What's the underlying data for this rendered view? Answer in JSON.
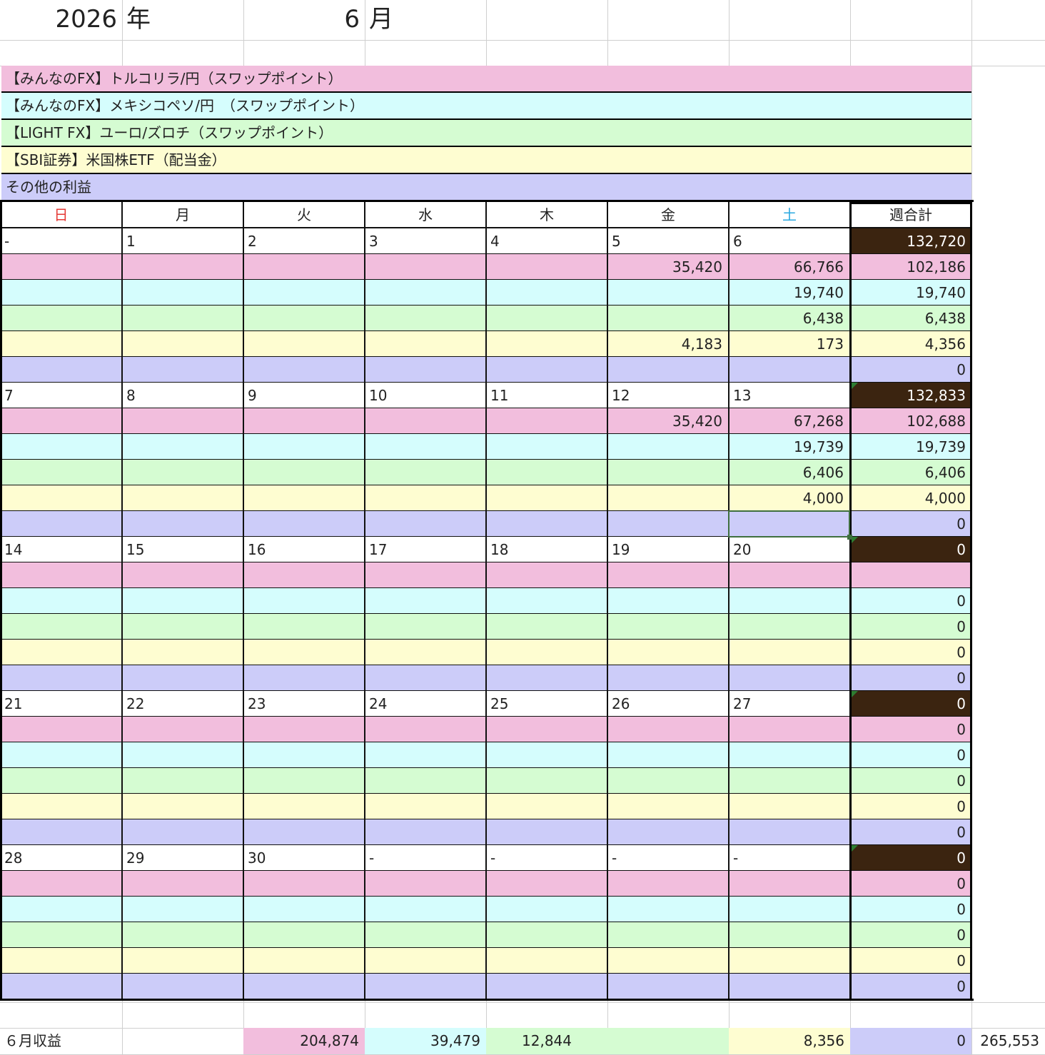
{
  "header": {
    "year": "2026",
    "year_unit": "年",
    "month": "6",
    "month_unit": "月"
  },
  "legend": [
    {
      "label": "【みんなのFX】トルコリラ/円（スワップポイント）",
      "color": "#f2bedd"
    },
    {
      "label": "【みんなのFX】メキシコペソ/円　（スワップポイント）",
      "color": "#d5fdfd"
    },
    {
      "label": "【LIGHT FX】ユーロ/ズロチ（スワップポイント）",
      "color": "#d5fcd2"
    },
    {
      "label": "【SBI証券】米国株ETF（配当金）",
      "color": "#fefdd1"
    },
    {
      "label": "その他の利益",
      "color": "#ccccf9"
    }
  ],
  "weekday_headers": [
    "日",
    "月",
    "火",
    "水",
    "木",
    "金",
    "土",
    "週合計"
  ],
  "weekday_colors": {
    "sunday": "#e53935",
    "saturday": "#29a8e0"
  },
  "weeks": [
    {
      "dates": [
        "-",
        "1",
        "2",
        "3",
        "4",
        "5",
        "6"
      ],
      "total": "132,720",
      "rows": [
        [
          "",
          "",
          "",
          "",
          "",
          "35,420",
          "66,766",
          "102,186"
        ],
        [
          "",
          "",
          "",
          "",
          "",
          "",
          "19,740",
          "19,740"
        ],
        [
          "",
          "",
          "",
          "",
          "",
          "",
          "6,438",
          "6,438"
        ],
        [
          "",
          "",
          "",
          "",
          "",
          "4,183",
          "173",
          "4,356"
        ],
        [
          "",
          "",
          "",
          "",
          "",
          "",
          "",
          "0"
        ]
      ]
    },
    {
      "dates": [
        "7",
        "8",
        "9",
        "10",
        "11",
        "12",
        "13"
      ],
      "total": "132,833",
      "rows": [
        [
          "",
          "",
          "",
          "",
          "",
          "35,420",
          "67,268",
          "102,688"
        ],
        [
          "",
          "",
          "",
          "",
          "",
          "",
          "19,739",
          "19,739"
        ],
        [
          "",
          "",
          "",
          "",
          "",
          "",
          "6,406",
          "6,406"
        ],
        [
          "",
          "",
          "",
          "",
          "",
          "",
          "4,000",
          "4,000"
        ],
        [
          "",
          "",
          "",
          "",
          "",
          "",
          "",
          "0"
        ]
      ]
    },
    {
      "dates": [
        "14",
        "15",
        "16",
        "17",
        "18",
        "19",
        "20"
      ],
      "total": "0",
      "rows": [
        [
          "",
          "",
          "",
          "",
          "",
          "",
          "",
          ""
        ],
        [
          "",
          "",
          "",
          "",
          "",
          "",
          "",
          "0"
        ],
        [
          "",
          "",
          "",
          "",
          "",
          "",
          "",
          "0"
        ],
        [
          "",
          "",
          "",
          "",
          "",
          "",
          "",
          "0"
        ],
        [
          "",
          "",
          "",
          "",
          "",
          "",
          "",
          "0"
        ]
      ]
    },
    {
      "dates": [
        "21",
        "22",
        "23",
        "24",
        "25",
        "26",
        "27"
      ],
      "total": "0",
      "rows": [
        [
          "",
          "",
          "",
          "",
          "",
          "",
          "",
          "0"
        ],
        [
          "",
          "",
          "",
          "",
          "",
          "",
          "",
          "0"
        ],
        [
          "",
          "",
          "",
          "",
          "",
          "",
          "",
          "0"
        ],
        [
          "",
          "",
          "",
          "",
          "",
          "",
          "",
          "0"
        ],
        [
          "",
          "",
          "",
          "",
          "",
          "",
          "",
          "0"
        ]
      ]
    },
    {
      "dates": [
        "28",
        "29",
        "30",
        "-",
        "-",
        "-",
        "-"
      ],
      "total": "0",
      "rows": [
        [
          "",
          "",
          "",
          "",
          "",
          "",
          "",
          "0"
        ],
        [
          "",
          "",
          "",
          "",
          "",
          "",
          "",
          "0"
        ],
        [
          "",
          "",
          "",
          "",
          "",
          "",
          "",
          "0"
        ],
        [
          "",
          "",
          "",
          "",
          "",
          "",
          "",
          "0"
        ],
        [
          "",
          "",
          "",
          "",
          "",
          "",
          "",
          "0"
        ]
      ]
    }
  ],
  "summary": {
    "label": "６月収益",
    "values": [
      "204,874",
      "39,479",
      "12,844",
      "8,356",
      "0"
    ],
    "grand_total": "265,553"
  }
}
